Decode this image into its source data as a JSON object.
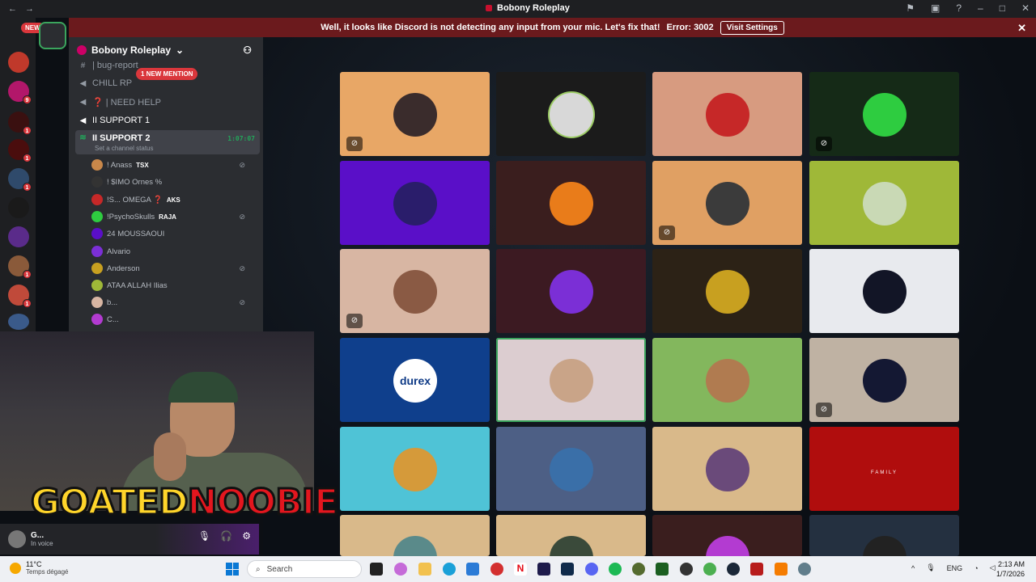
{
  "titlebar": {
    "title": "Bobony Roleplay"
  },
  "banner": {
    "message": "Well, it looks like Discord is not detecting any input from your mic. Let's fix that!",
    "error": "Error: 3002",
    "button": "Visit Settings"
  },
  "rail": {
    "new_label": "NEW"
  },
  "guild": {
    "name": "Bobony Roleplay"
  },
  "mention_pill": "1 NEW MENTION",
  "channels": [
    {
      "name": "| bug-report",
      "icon": "hash-icon"
    },
    {
      "name": "CHILL RP",
      "icon": "speaker-icon"
    },
    {
      "name": "❓ | NEED HELP",
      "icon": "speaker-icon"
    },
    {
      "name": "II SUPPORT 1",
      "icon": "speaker-icon"
    },
    {
      "name": "II SUPPORT 2",
      "icon": "speaker-icon",
      "timer": "1:07:07",
      "status": "Set a channel status"
    }
  ],
  "voice_users": [
    {
      "name": "! Anass",
      "tag": "TSX",
      "muted": true
    },
    {
      "name": "! $IMO Ornes %",
      "tag": "",
      "muted": false
    },
    {
      "name": "!S... OMEGA ❓",
      "tag": "AKS",
      "muted": false
    },
    {
      "name": "!PsychoSkulls",
      "tag": "RAJA",
      "muted": true
    },
    {
      "name": "24 MOUSSAOUI",
      "tag": "",
      "muted": false
    },
    {
      "name": "Alvario",
      "tag": "",
      "muted": false
    },
    {
      "name": "Anderson",
      "tag": "",
      "muted": true
    },
    {
      "name": "ATAA ALLAH Ilias",
      "tag": "",
      "muted": false
    },
    {
      "name": "b...",
      "tag": "",
      "muted": true
    },
    {
      "name": "C...",
      "tag": "",
      "muted": false
    }
  ],
  "overlay": {
    "logo_part1": "GOATED",
    "logo_part2": "NOOBIE"
  },
  "userpanel": {
    "name": "G...",
    "status": "In voice"
  },
  "tiles": [
    {
      "bg": "#e8a766",
      "av": "#3a2c2c",
      "mute": true
    },
    {
      "bg": "#1b1b1b",
      "av": "#d8d8d8",
      "mute": false,
      "ring": "#9ccc65"
    },
    {
      "bg": "#d79b80",
      "av": "#c62828",
      "mute": false
    },
    {
      "bg": "#152a17",
      "av": "#2ecc40",
      "mute": true
    },
    {
      "bg": "#5a0fc8",
      "av": "#2a1d6b",
      "mute": false
    },
    {
      "bg": "#3a1e1e",
      "av": "#e97c1a",
      "mute": false
    },
    {
      "bg": "#e0a063",
      "av": "#3b3b3b",
      "mute": true
    },
    {
      "bg": "#9fb838",
      "av": "#c9d9b5",
      "mute": false
    },
    {
      "bg": "#d8b6a3",
      "av": "#8a5a44",
      "mute": true
    },
    {
      "bg": "#3c1a22",
      "av": "#7b2fd6",
      "mute": false
    },
    {
      "bg": "#2c2216",
      "av": "#c8a020",
      "mute": false
    },
    {
      "bg": "#e8eaee",
      "av": "#121526",
      "mute": false
    },
    {
      "bg": "#0f3f8c",
      "av": "#ffffff",
      "mute": false,
      "durex": "durex"
    },
    {
      "bg": "#dccdd0",
      "av": "#c9a488",
      "mute": false,
      "speaking": true
    },
    {
      "bg": "#83b75d",
      "av": "#b07b50",
      "mute": false
    },
    {
      "bg": "#bfb2a3",
      "av": "#141833",
      "mute": true
    },
    {
      "bg": "#4fc3d6",
      "av": "#d59a3a",
      "mute": false
    },
    {
      "bg": "#4d5f85",
      "av": "#3a6fa8",
      "mute": false
    },
    {
      "bg": "#d9b98a",
      "av": "#6a4a7a",
      "mute": false
    },
    {
      "bg": "#b00d0d",
      "av": "#b00d0d",
      "mute": false,
      "family": "FAMILY"
    },
    {
      "bg": "#d9b98a",
      "av": "#5a8a8a",
      "mute": false
    },
    {
      "bg": "#d9b98a",
      "av": "#3a4a3a",
      "mute": false
    },
    {
      "bg": "#3a1e1e",
      "av": "#b33bd1",
      "mute": false
    },
    {
      "bg": "#243040",
      "av": "#222222",
      "mute": false
    }
  ],
  "taskbar": {
    "temp": "11°C",
    "weather": "Temps dégagé",
    "search": "Search",
    "lang": "ENG",
    "time": "2:13 AM",
    "date": "1/7/2026"
  }
}
